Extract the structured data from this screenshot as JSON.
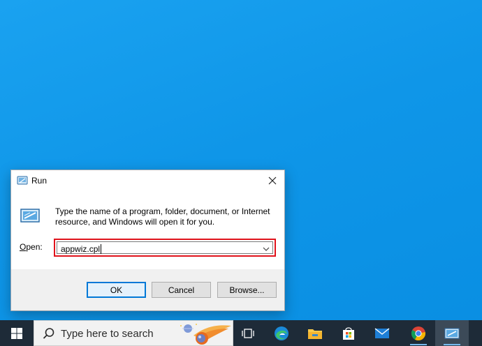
{
  "dialog": {
    "title": "Run",
    "description": "Type the name of a program, folder, document, or Internet resource, and Windows will open it for you.",
    "open_label_accel": "O",
    "open_label_rest": "pen:",
    "open_value": "appwiz.cpl",
    "buttons": {
      "ok": "OK",
      "cancel": "Cancel",
      "browse": "Browse..."
    },
    "highlight_color": "#e0121b"
  },
  "taskbar": {
    "search_placeholder": "Type here to search",
    "icons": [
      "windows-start-icon",
      "task-view-icon",
      "edge-icon",
      "file-explorer-icon",
      "microsoft-store-icon",
      "mail-icon",
      "chrome-icon",
      "run-app-icon"
    ],
    "accent": "#76b9ed"
  }
}
